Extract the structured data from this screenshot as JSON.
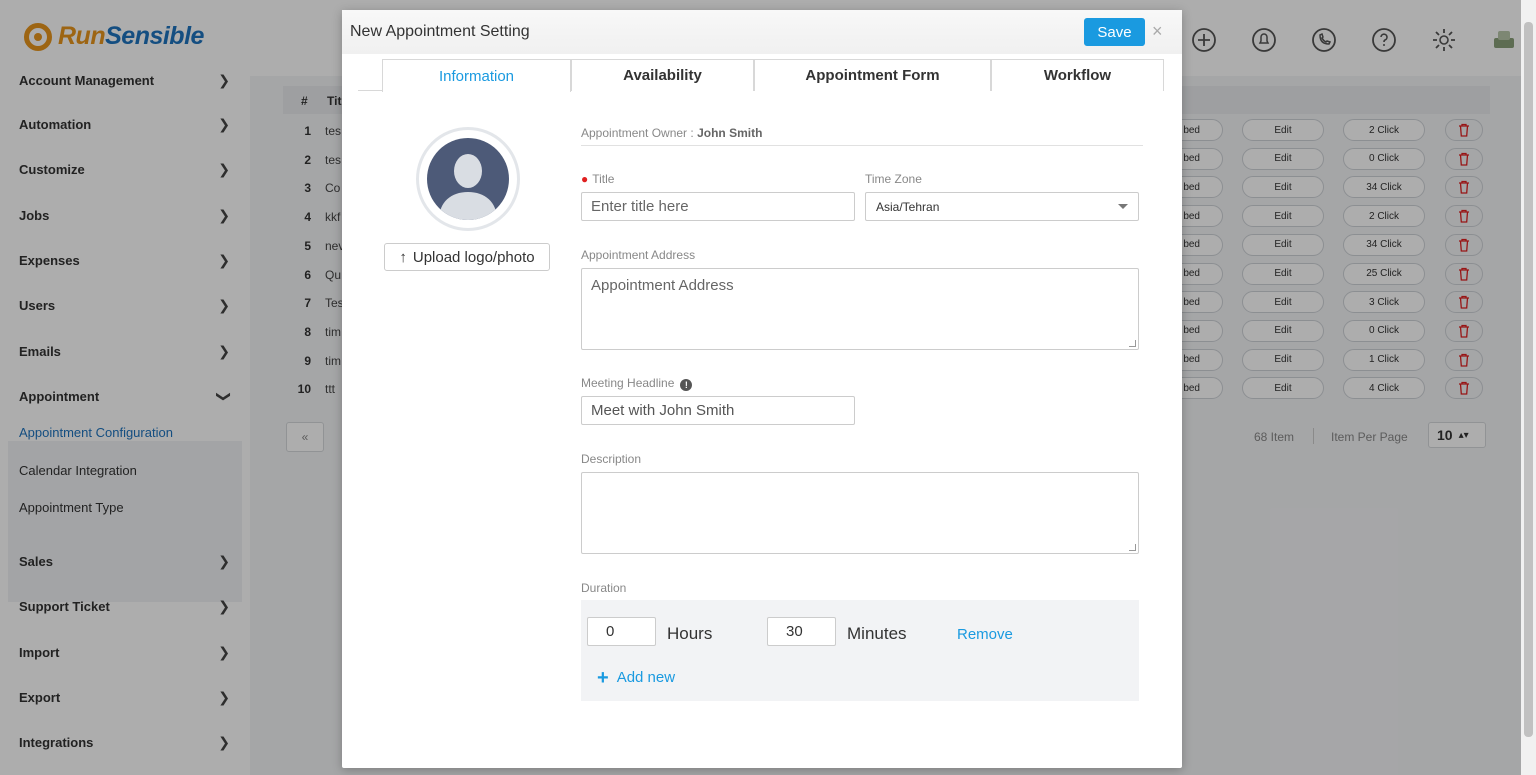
{
  "app": {
    "logo": {
      "run": "Run",
      "sensible": "Sensible"
    },
    "sidebar": {
      "items": [
        {
          "label": "Account Management"
        },
        {
          "label": "Automation"
        },
        {
          "label": "Customize"
        },
        {
          "label": "Jobs"
        },
        {
          "label": "Expenses"
        },
        {
          "label": "Users"
        },
        {
          "label": "Emails"
        },
        {
          "label": "Appointment"
        },
        {
          "label": "Sales"
        },
        {
          "label": "Support Ticket"
        },
        {
          "label": "Import"
        },
        {
          "label": "Export"
        },
        {
          "label": "Integrations"
        }
      ],
      "subitems": [
        {
          "label": "Appointment Configuration",
          "active": true
        },
        {
          "label": "Calendar Integration"
        },
        {
          "label": "Appointment Type"
        }
      ]
    },
    "table": {
      "headers": {
        "num": "#",
        "title": "Tit"
      },
      "rows": [
        {
          "num": "1",
          "title": "tes",
          "status": "bed",
          "edit": "Edit",
          "clicks": "2 Click"
        },
        {
          "num": "2",
          "title": "tes",
          "status": "bed",
          "edit": "Edit",
          "clicks": "0 Click"
        },
        {
          "num": "3",
          "title": "Co",
          "status": "bed",
          "edit": "Edit",
          "clicks": "34 Click"
        },
        {
          "num": "4",
          "title": "kkf",
          "status": "bed",
          "edit": "Edit",
          "clicks": "2 Click"
        },
        {
          "num": "5",
          "title": "nev",
          "status": "bed",
          "edit": "Edit",
          "clicks": "34 Click"
        },
        {
          "num": "6",
          "title": "Qu",
          "status": "bed",
          "edit": "Edit",
          "clicks": "25 Click"
        },
        {
          "num": "7",
          "title": "Tes",
          "status": "bed",
          "edit": "Edit",
          "clicks": "3 Click"
        },
        {
          "num": "8",
          "title": "tim",
          "status": "bed",
          "edit": "Edit",
          "clicks": "0 Click"
        },
        {
          "num": "9",
          "title": "tim",
          "status": "bed",
          "edit": "Edit",
          "clicks": "1 Click"
        },
        {
          "num": "10",
          "title": "ttt",
          "status": "bed",
          "edit": "Edit",
          "clicks": "4 Click"
        }
      ],
      "pagination_prev": "«",
      "items_count": "68 Item",
      "per_page_label": "Item Per Page",
      "per_page_value": "10"
    },
    "colors": {
      "accent": "#1a9ae0",
      "brand_orange": "#e8951c",
      "brand_blue": "#1e73be",
      "danger": "#e02020"
    }
  },
  "modal": {
    "title": "New Appointment Setting",
    "save_label": "Save",
    "close_glyph": "×",
    "tabs": [
      {
        "label": "Information",
        "active": true
      },
      {
        "label": "Availability"
      },
      {
        "label": "Appointment Form"
      },
      {
        "label": "Workflow"
      }
    ],
    "upload_label": "Upload logo/photo",
    "owner_label": "Appointment Owner :",
    "owner_name": "John Smith",
    "title_label": "Title",
    "title_placeholder": "Enter title here",
    "timezone_label": "Time Zone",
    "timezone_value": "Asia/Tehran",
    "address_label": "Appointment Address",
    "address_placeholder": "Appointment Address",
    "headline_label": "Meeting Headline",
    "headline_value": "Meet with John Smith",
    "description_label": "Description",
    "description_value": "",
    "duration_label": "Duration",
    "duration": {
      "hours": "0",
      "hours_label": "Hours",
      "minutes": "30",
      "minutes_label": "Minutes",
      "remove_label": "Remove",
      "add_new_label": "Add new"
    }
  }
}
